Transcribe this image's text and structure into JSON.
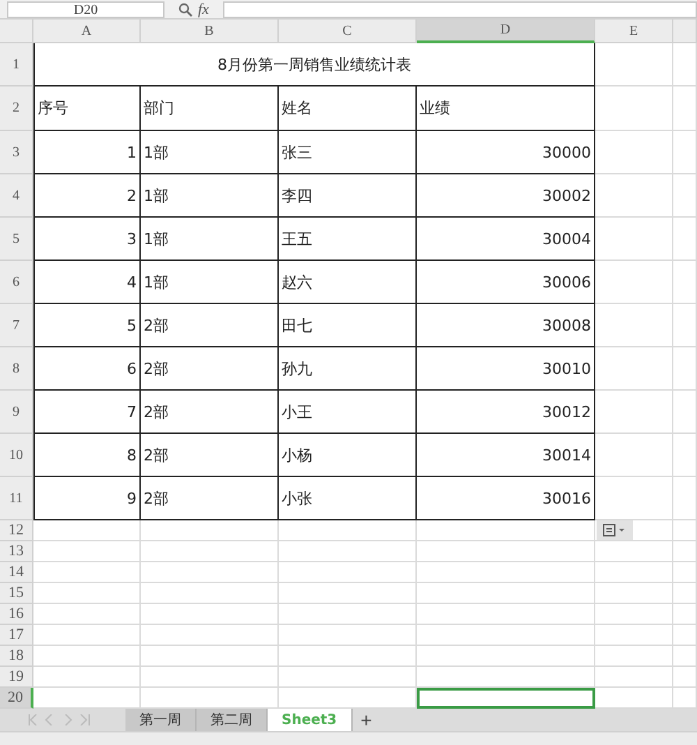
{
  "name_box": "D20",
  "formula_icon": "fx",
  "columns": [
    {
      "label": "A",
      "selected": false
    },
    {
      "label": "B",
      "selected": false
    },
    {
      "label": "C",
      "selected": false
    },
    {
      "label": "D",
      "selected": true
    },
    {
      "label": "E",
      "selected": false
    }
  ],
  "row_headers": [
    {
      "label": "1",
      "selected": false
    },
    {
      "label": "2",
      "selected": false
    },
    {
      "label": "3",
      "selected": false
    },
    {
      "label": "4",
      "selected": false
    },
    {
      "label": "5",
      "selected": false
    },
    {
      "label": "6",
      "selected": false
    },
    {
      "label": "7",
      "selected": false
    },
    {
      "label": "8",
      "selected": false
    },
    {
      "label": "9",
      "selected": false
    },
    {
      "label": "10",
      "selected": false
    },
    {
      "label": "11",
      "selected": false
    },
    {
      "label": "12",
      "selected": false
    },
    {
      "label": "13",
      "selected": false
    },
    {
      "label": "14",
      "selected": false
    },
    {
      "label": "15",
      "selected": false
    },
    {
      "label": "16",
      "selected": false
    },
    {
      "label": "17",
      "selected": false
    },
    {
      "label": "18",
      "selected": false
    },
    {
      "label": "19",
      "selected": false
    },
    {
      "label": "20",
      "selected": true
    }
  ],
  "title": "8月份第一周销售业绩统计表",
  "headers": [
    "序号",
    "部门",
    "姓名",
    "业绩"
  ],
  "rows": [
    {
      "index": "1",
      "dept": "1部",
      "name": "张三",
      "sales": "30000"
    },
    {
      "index": "2",
      "dept": "1部",
      "name": "李四",
      "sales": "30002"
    },
    {
      "index": "3",
      "dept": "1部",
      "name": "王五",
      "sales": "30004"
    },
    {
      "index": "4",
      "dept": "1部",
      "name": "赵六",
      "sales": "30006"
    },
    {
      "index": "5",
      "dept": "2部",
      "name": "田七",
      "sales": "30008"
    },
    {
      "index": "6",
      "dept": "2部",
      "name": "孙九",
      "sales": "30010"
    },
    {
      "index": "7",
      "dept": "2部",
      "name": "小王",
      "sales": "30012"
    },
    {
      "index": "8",
      "dept": "2部",
      "name": "小杨",
      "sales": "30014"
    },
    {
      "index": "9",
      "dept": "2部",
      "name": "小张",
      "sales": "30016"
    }
  ],
  "sheet_tabs": [
    {
      "label": "第一周",
      "selected": false
    },
    {
      "label": "第二周",
      "selected": false
    },
    {
      "label": "Sheet3",
      "selected": true
    }
  ],
  "add_sheet": "+"
}
